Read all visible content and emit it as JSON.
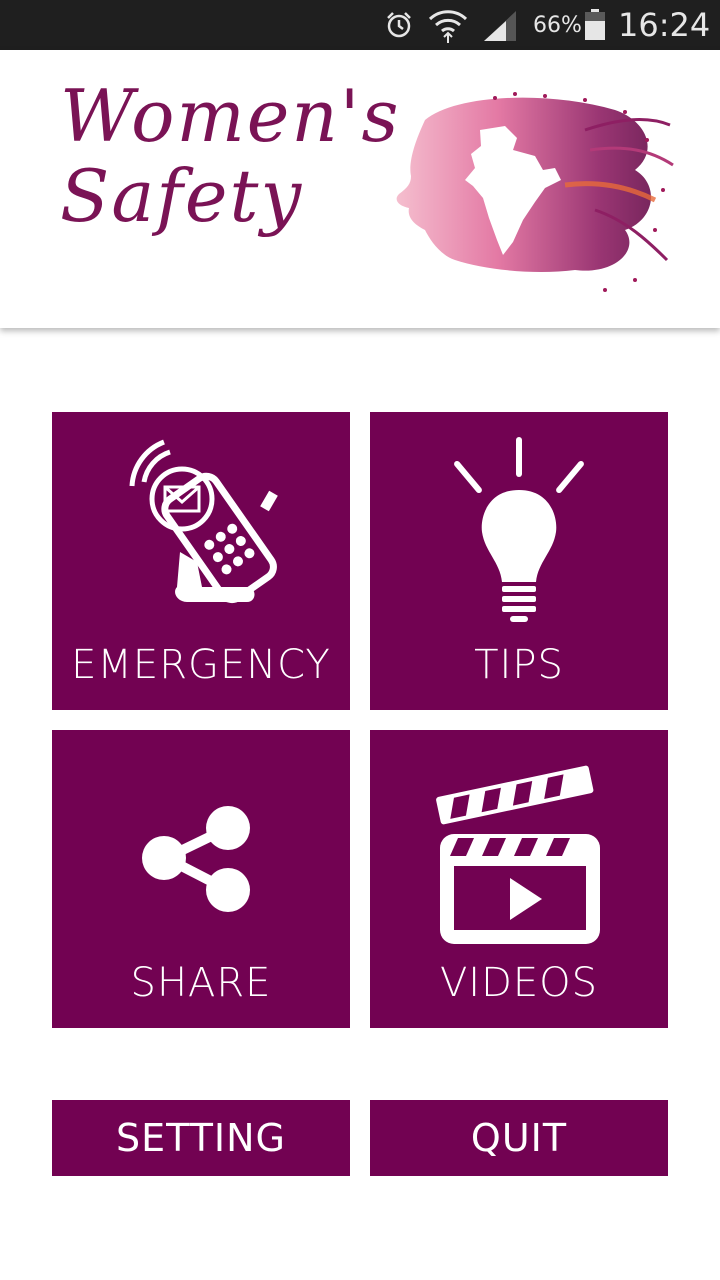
{
  "status_bar": {
    "battery_percent": "66%",
    "time": "16:24",
    "icons": [
      "alarm-icon",
      "wifi-icon",
      "signal-icon",
      "battery-icon"
    ]
  },
  "header": {
    "logo_line1": "Women's",
    "logo_line2": "Safety",
    "art": "woman-silhouette-india-map-icon"
  },
  "tiles": [
    {
      "label": "EMERGENCY",
      "icon": "phone-message-icon"
    },
    {
      "label": "TIPS",
      "icon": "lightbulb-icon"
    },
    {
      "label": "SHARE",
      "icon": "share-icon"
    },
    {
      "label": "VIDEOS",
      "icon": "clapperboard-icon"
    }
  ],
  "buttons": {
    "setting": "SETTING",
    "quit": "QUIT"
  },
  "colors": {
    "primary": "#720252",
    "status_bar": "#1f1f1f",
    "background": "#ffffff"
  }
}
